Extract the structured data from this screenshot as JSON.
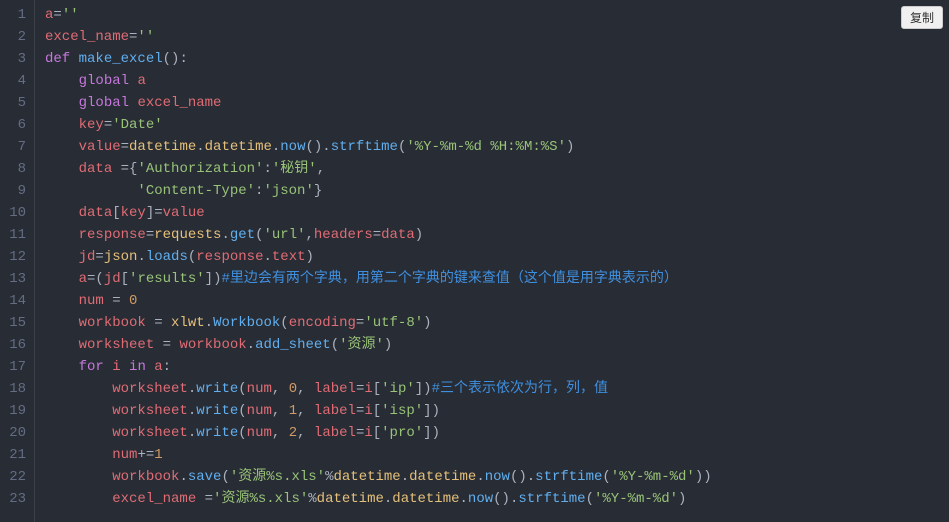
{
  "copy_button_label": "复制",
  "line_count": 23,
  "tokens": {
    "l1": [
      [
        "var",
        "a"
      ],
      [
        "default",
        "="
      ],
      [
        "string",
        "''"
      ]
    ],
    "l2": [
      [
        "var",
        "excel_name"
      ],
      [
        "default",
        "="
      ],
      [
        "string",
        "''"
      ]
    ],
    "l3": [
      [
        "keyword",
        "def"
      ],
      [
        "default",
        " "
      ],
      [
        "func",
        "make_excel"
      ],
      [
        "default",
        "():"
      ]
    ],
    "l4": [
      [
        "default",
        "    "
      ],
      [
        "keyword",
        "global"
      ],
      [
        "default",
        " "
      ],
      [
        "var",
        "a"
      ]
    ],
    "l5": [
      [
        "default",
        "    "
      ],
      [
        "keyword",
        "global"
      ],
      [
        "default",
        " "
      ],
      [
        "var",
        "excel_name"
      ]
    ],
    "l6": [
      [
        "default",
        "    "
      ],
      [
        "var",
        "key"
      ],
      [
        "default",
        "="
      ],
      [
        "string",
        "'Date'"
      ]
    ],
    "l7": [
      [
        "default",
        "    "
      ],
      [
        "var",
        "value"
      ],
      [
        "default",
        "="
      ],
      [
        "prop",
        "datetime"
      ],
      [
        "default",
        "."
      ],
      [
        "prop",
        "datetime"
      ],
      [
        "default",
        "."
      ],
      [
        "func",
        "now"
      ],
      [
        "default",
        "()."
      ],
      [
        "func",
        "strftime"
      ],
      [
        "default",
        "("
      ],
      [
        "string",
        "'%Y-%m-%d %H:%M:%S'"
      ],
      [
        "default",
        ")"
      ]
    ],
    "l8": [
      [
        "default",
        "    "
      ],
      [
        "var",
        "data"
      ],
      [
        "default",
        " ={"
      ],
      [
        "string",
        "'Authorization'"
      ],
      [
        "default",
        ":"
      ],
      [
        "string",
        "'秘钥'"
      ],
      [
        "default",
        ","
      ]
    ],
    "l9": [
      [
        "default",
        "           "
      ],
      [
        "string",
        "'Content-Type'"
      ],
      [
        "default",
        ":"
      ],
      [
        "string",
        "'json'"
      ],
      [
        "default",
        "}"
      ]
    ],
    "l10": [
      [
        "default",
        "    "
      ],
      [
        "var",
        "data"
      ],
      [
        "default",
        "["
      ],
      [
        "var",
        "key"
      ],
      [
        "default",
        "]="
      ],
      [
        "var",
        "value"
      ]
    ],
    "l11": [
      [
        "default",
        "    "
      ],
      [
        "var",
        "response"
      ],
      [
        "default",
        "="
      ],
      [
        "prop",
        "requests"
      ],
      [
        "default",
        "."
      ],
      [
        "func",
        "get"
      ],
      [
        "default",
        "("
      ],
      [
        "string",
        "'url'"
      ],
      [
        "default",
        ","
      ],
      [
        "var",
        "headers"
      ],
      [
        "default",
        "="
      ],
      [
        "var",
        "data"
      ],
      [
        "default",
        ")"
      ]
    ],
    "l12": [
      [
        "default",
        "    "
      ],
      [
        "var",
        "jd"
      ],
      [
        "default",
        "="
      ],
      [
        "prop",
        "json"
      ],
      [
        "default",
        "."
      ],
      [
        "func",
        "loads"
      ],
      [
        "default",
        "("
      ],
      [
        "var",
        "response"
      ],
      [
        "default",
        "."
      ],
      [
        "var",
        "text"
      ],
      [
        "default",
        ")"
      ]
    ],
    "l13": [
      [
        "default",
        "    "
      ],
      [
        "var",
        "a"
      ],
      [
        "default",
        "=("
      ],
      [
        "var",
        "jd"
      ],
      [
        "default",
        "["
      ],
      [
        "string",
        "'results'"
      ],
      [
        "default",
        "])"
      ],
      [
        "comment",
        "#里边会有两个字典，用第二个字典的键来查值（这个值是用字典表示的）"
      ]
    ],
    "l14": [
      [
        "default",
        "    "
      ],
      [
        "var",
        "num"
      ],
      [
        "default",
        " = "
      ],
      [
        "number",
        "0"
      ]
    ],
    "l15": [
      [
        "default",
        "    "
      ],
      [
        "var",
        "workbook"
      ],
      [
        "default",
        " = "
      ],
      [
        "prop",
        "xlwt"
      ],
      [
        "default",
        "."
      ],
      [
        "func",
        "Workbook"
      ],
      [
        "default",
        "("
      ],
      [
        "var",
        "encoding"
      ],
      [
        "default",
        "="
      ],
      [
        "string",
        "'utf-8'"
      ],
      [
        "default",
        ")"
      ]
    ],
    "l16": [
      [
        "default",
        "    "
      ],
      [
        "var",
        "worksheet"
      ],
      [
        "default",
        " = "
      ],
      [
        "var",
        "workbook"
      ],
      [
        "default",
        "."
      ],
      [
        "func",
        "add_sheet"
      ],
      [
        "default",
        "("
      ],
      [
        "string",
        "'资源'"
      ],
      [
        "default",
        ")"
      ]
    ],
    "l17": [
      [
        "default",
        "    "
      ],
      [
        "keyword",
        "for"
      ],
      [
        "default",
        " "
      ],
      [
        "var",
        "i"
      ],
      [
        "default",
        " "
      ],
      [
        "keyword",
        "in"
      ],
      [
        "default",
        " "
      ],
      [
        "var",
        "a"
      ],
      [
        "default",
        ":"
      ]
    ],
    "l18": [
      [
        "default",
        "        "
      ],
      [
        "var",
        "worksheet"
      ],
      [
        "default",
        "."
      ],
      [
        "func",
        "write"
      ],
      [
        "default",
        "("
      ],
      [
        "var",
        "num"
      ],
      [
        "default",
        ", "
      ],
      [
        "number",
        "0"
      ],
      [
        "default",
        ", "
      ],
      [
        "var",
        "label"
      ],
      [
        "default",
        "="
      ],
      [
        "var",
        "i"
      ],
      [
        "default",
        "["
      ],
      [
        "string",
        "'ip'"
      ],
      [
        "default",
        "])"
      ],
      [
        "comment",
        "#三个表示依次为行，列，值"
      ]
    ],
    "l19": [
      [
        "default",
        "        "
      ],
      [
        "var",
        "worksheet"
      ],
      [
        "default",
        "."
      ],
      [
        "func",
        "write"
      ],
      [
        "default",
        "("
      ],
      [
        "var",
        "num"
      ],
      [
        "default",
        ", "
      ],
      [
        "number",
        "1"
      ],
      [
        "default",
        ", "
      ],
      [
        "var",
        "label"
      ],
      [
        "default",
        "="
      ],
      [
        "var",
        "i"
      ],
      [
        "default",
        "["
      ],
      [
        "string",
        "'isp'"
      ],
      [
        "default",
        "])"
      ]
    ],
    "l20": [
      [
        "default",
        "        "
      ],
      [
        "var",
        "worksheet"
      ],
      [
        "default",
        "."
      ],
      [
        "func",
        "write"
      ],
      [
        "default",
        "("
      ],
      [
        "var",
        "num"
      ],
      [
        "default",
        ", "
      ],
      [
        "number",
        "2"
      ],
      [
        "default",
        ", "
      ],
      [
        "var",
        "label"
      ],
      [
        "default",
        "="
      ],
      [
        "var",
        "i"
      ],
      [
        "default",
        "["
      ],
      [
        "string",
        "'pro'"
      ],
      [
        "default",
        "])"
      ]
    ],
    "l21": [
      [
        "default",
        "        "
      ],
      [
        "var",
        "num"
      ],
      [
        "default",
        "+="
      ],
      [
        "number",
        "1"
      ]
    ],
    "l22": [
      [
        "default",
        "        "
      ],
      [
        "var",
        "workbook"
      ],
      [
        "default",
        "."
      ],
      [
        "func",
        "save"
      ],
      [
        "default",
        "("
      ],
      [
        "string",
        "'资源%s.xls'"
      ],
      [
        "default",
        "%"
      ],
      [
        "prop",
        "datetime"
      ],
      [
        "default",
        "."
      ],
      [
        "prop",
        "datetime"
      ],
      [
        "default",
        "."
      ],
      [
        "func",
        "now"
      ],
      [
        "default",
        "()."
      ],
      [
        "func",
        "strftime"
      ],
      [
        "default",
        "("
      ],
      [
        "string",
        "'%Y-%m-%d'"
      ],
      [
        "default",
        "))"
      ]
    ],
    "l23": [
      [
        "default",
        "        "
      ],
      [
        "var",
        "excel_name"
      ],
      [
        "default",
        " ="
      ],
      [
        "string",
        "'资源%s.xls'"
      ],
      [
        "default",
        "%"
      ],
      [
        "prop",
        "datetime"
      ],
      [
        "default",
        "."
      ],
      [
        "prop",
        "datetime"
      ],
      [
        "default",
        "."
      ],
      [
        "func",
        "now"
      ],
      [
        "default",
        "()."
      ],
      [
        "func",
        "strftime"
      ],
      [
        "default",
        "("
      ],
      [
        "string",
        "'%Y-%m-%d'"
      ],
      [
        "default",
        ")"
      ]
    ]
  }
}
